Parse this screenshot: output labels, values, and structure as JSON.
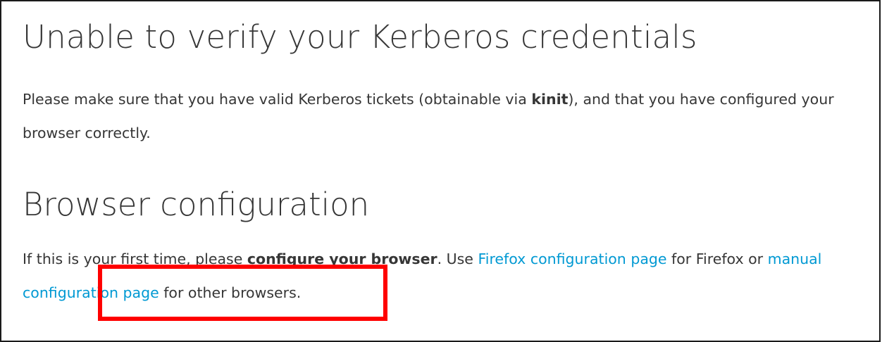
{
  "error": {
    "title": "Unable to verify your Kerberos credentials",
    "text_before": "Please make sure that you have valid Kerberos tickets (obtainable via ",
    "command": "kinit",
    "text_after": "), and that you have configured your browser correctly."
  },
  "browser_config": {
    "title": "Browser configuration",
    "text_1": "If this is your first time, please ",
    "strong": "configure your browser",
    "text_2": ". Use ",
    "firefox_link": "Firefox configuration page",
    "text_3": " for Firefox or ",
    "manual_link": "manual configuration page",
    "text_4": " for other browsers."
  },
  "colors": {
    "text": "#363636",
    "link": "#0099d3",
    "highlight": "#ff0000",
    "border": "#1a1a1a"
  }
}
